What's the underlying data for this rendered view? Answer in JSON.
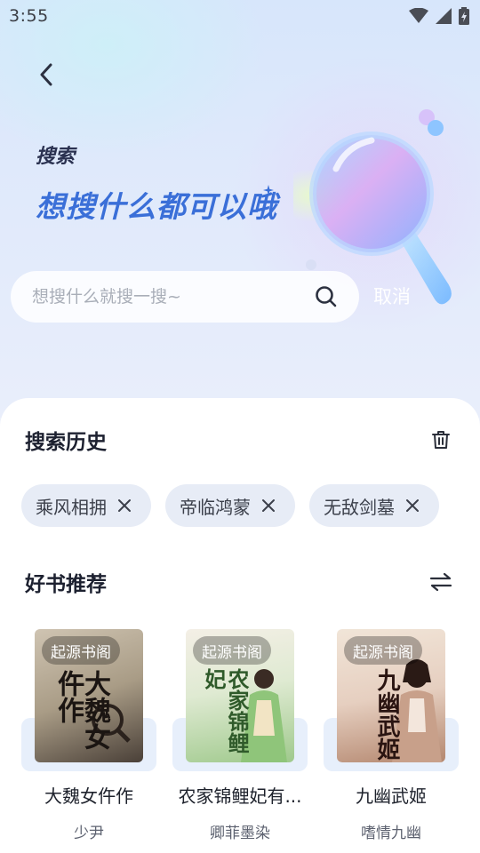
{
  "status_bar": {
    "time": "3:55"
  },
  "hero": {
    "small_title": "搜索",
    "big_title": "想搜什么都可以哦"
  },
  "search": {
    "placeholder": "想搜什么就搜一搜~",
    "value": "",
    "cancel_label": "取消"
  },
  "history": {
    "title": "搜索历史",
    "chips": [
      {
        "label": "乘风相拥"
      },
      {
        "label": "帝临鸿蒙"
      },
      {
        "label": "无敌剑墓"
      }
    ]
  },
  "recommend": {
    "title": "好书推荐",
    "books": [
      {
        "tag": "起源书阁",
        "title": "大魏女仵作",
        "author": "少尹",
        "cover_text": "大魏女仵作"
      },
      {
        "tag": "起源书阁",
        "title": "农家锦鲤妃有...",
        "author": "卿菲墨染",
        "cover_text": "农家锦鲤妃"
      },
      {
        "tag": "起源书阁",
        "title": "九幽武姬",
        "author": "嗜情九幽",
        "cover_text": "九幽武姬"
      }
    ]
  }
}
